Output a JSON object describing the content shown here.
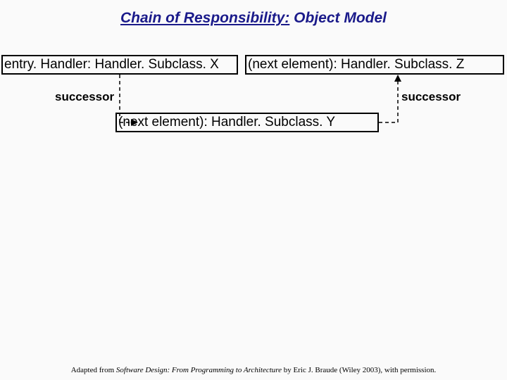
{
  "title": {
    "underlined": "Chain of Responsibility:",
    "rest": " Object Model"
  },
  "boxes": {
    "entry": "entry. Handler: Handler. Subclass. X",
    "nextZ": "(next element): Handler. Subclass. Z",
    "nextY": "(next element): Handler. Subclass. Y"
  },
  "labels": {
    "successor_left": "successor",
    "successor_right": "successor"
  },
  "attribution": {
    "prefix": "Adapted from ",
    "italic": "Software Design: From Programming to Architecture",
    "suffix": " by Eric J. Braude (Wiley 2003), with permission."
  }
}
